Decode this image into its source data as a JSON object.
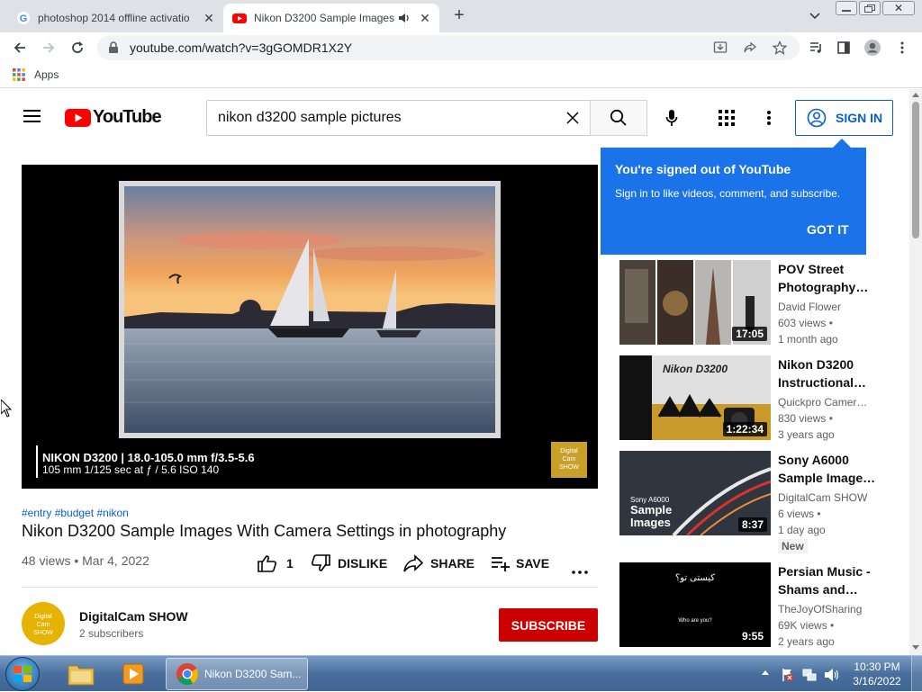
{
  "browser": {
    "tabs": [
      {
        "title": "photoshop 2014 offline activatio",
        "close": "✕"
      },
      {
        "title": "Nikon D3200 Sample Images",
        "close": "✕"
      }
    ],
    "new_tab": "+",
    "url": "youtube.com/watch?v=3gGOMDR1X2Y",
    "bookmarks": {
      "apps_label": "Apps"
    }
  },
  "youtube": {
    "logo_text": "YouTube",
    "search_value": "nikon d3200 sample pictures",
    "sign_in_label": "SIGN IN",
    "popup": {
      "title": "You're signed out of YouTube",
      "body": "Sign in to like videos, comment, and subscribe.",
      "button": "GOT IT"
    },
    "video": {
      "caption_line1": "NIKON D3200 | 18.0-105.0 mm f/3.5-5.6",
      "caption_line2": "105 mm 1/125 sec at ƒ / 5.6 ISO 140",
      "watermark": [
        "Digital",
        "Cam",
        "SHOW"
      ],
      "hashtags": [
        "#entry",
        "#budget",
        "#nikon"
      ],
      "title": "Nikon D3200 Sample Images With Camera Settings in photography",
      "views_date": "48 views • Mar 4, 2022",
      "like_count": "1",
      "dislike_label": "DISLIKE",
      "share_label": "SHARE",
      "save_label": "SAVE"
    },
    "channel": {
      "name": "DigitalCam SHOW",
      "subscribers": "2 subscribers",
      "avatar_text": [
        "Digital",
        "Cam",
        "SHOW"
      ],
      "subscribe_label": "SUBSCRIBE"
    },
    "suggestions": [
      {
        "title": "POV Street Photography…",
        "channel": "David Flower",
        "views": "603 views •",
        "age": "1 month ago",
        "duration": "17:05"
      },
      {
        "title": "Nikon D3200 Instructional…",
        "channel": "Quickpro Camer…",
        "views": "830 views •",
        "age": "3 years ago",
        "duration": "1:22:34",
        "thumb_text": "Nikon D3200"
      },
      {
        "title": "Sony A6000 Sample Image…",
        "channel": "DigitalCam SHOW",
        "views": "6 views •",
        "age": "1 day ago",
        "duration": "8:37",
        "badge": "New",
        "thumb_text": [
          "Sony A6000",
          "Sample",
          "Images"
        ]
      },
      {
        "title": "Persian Music - Shams and…",
        "channel": "TheJoyOfSharing",
        "views": "69K views •",
        "age": "2 years ago",
        "duration": "9:55",
        "thumb_text": [
          "کیستی تو؟",
          "Who are you?"
        ]
      }
    ]
  },
  "taskbar": {
    "chrome_task_label": "Nikon D3200 Sam...",
    "time": "10:30 PM",
    "date": "3/16/2022"
  }
}
